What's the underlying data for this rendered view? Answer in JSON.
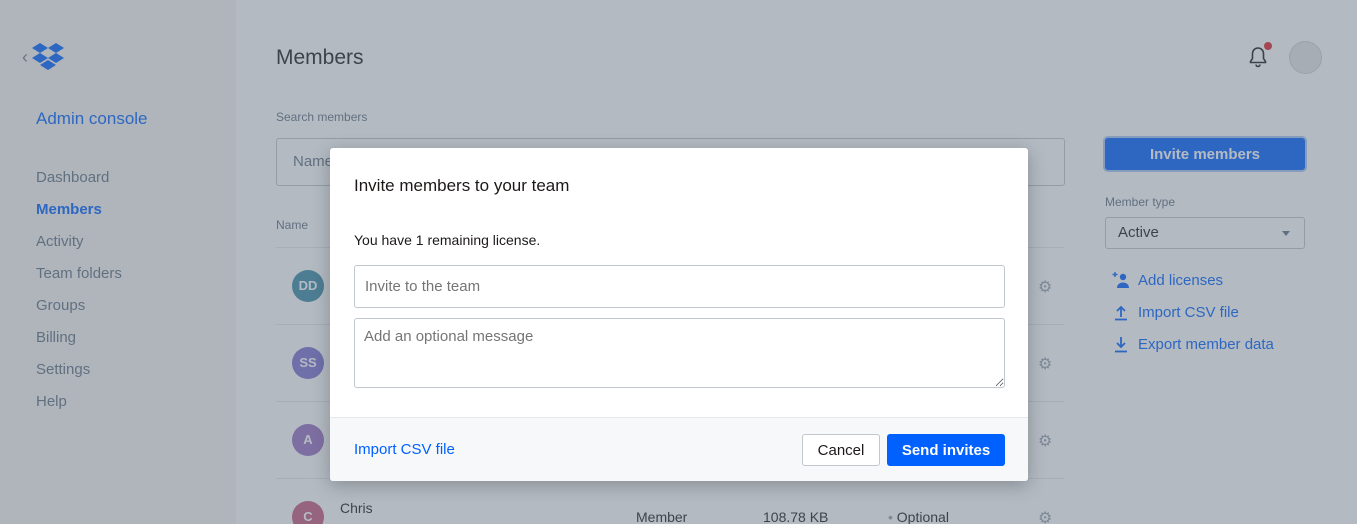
{
  "sidebar": {
    "title": "Admin console",
    "items": [
      {
        "label": "Dashboard"
      },
      {
        "label": "Members"
      },
      {
        "label": "Activity"
      },
      {
        "label": "Team folders"
      },
      {
        "label": "Groups"
      },
      {
        "label": "Billing"
      },
      {
        "label": "Settings"
      },
      {
        "label": "Help"
      }
    ]
  },
  "header": {
    "title": "Members"
  },
  "search": {
    "label": "Search members",
    "placeholder": "Name"
  },
  "table": {
    "name_header": "Name",
    "rows": [
      {
        "initials": "DD",
        "color": "#3d8aa6"
      },
      {
        "initials": "SS",
        "color": "#7d6fd1"
      },
      {
        "initials": "A",
        "color": "#9a6fc2"
      },
      {
        "initials": "C",
        "color": "#c75a7d",
        "name": "Chris",
        "role": "Member",
        "storage": "108.78 KB",
        "status": "Optional"
      }
    ]
  },
  "right_panel": {
    "invite_button": "Invite members",
    "member_type_label": "Member type",
    "member_type_value": "Active",
    "links": [
      {
        "label": "Add licenses",
        "icon": "add-user-icon"
      },
      {
        "label": "Import CSV file",
        "icon": "upload-icon"
      },
      {
        "label": "Export member data",
        "icon": "download-icon"
      }
    ]
  },
  "modal": {
    "title": "Invite members to your team",
    "license_text": "You have 1 remaining license.",
    "invite_placeholder": "Invite to the team",
    "message_placeholder": "Add an optional message",
    "import_link": "Import CSV file",
    "cancel": "Cancel",
    "send": "Send invites"
  },
  "colors": {
    "accent": "#0061fe",
    "notification_dot": "#e0242a"
  }
}
